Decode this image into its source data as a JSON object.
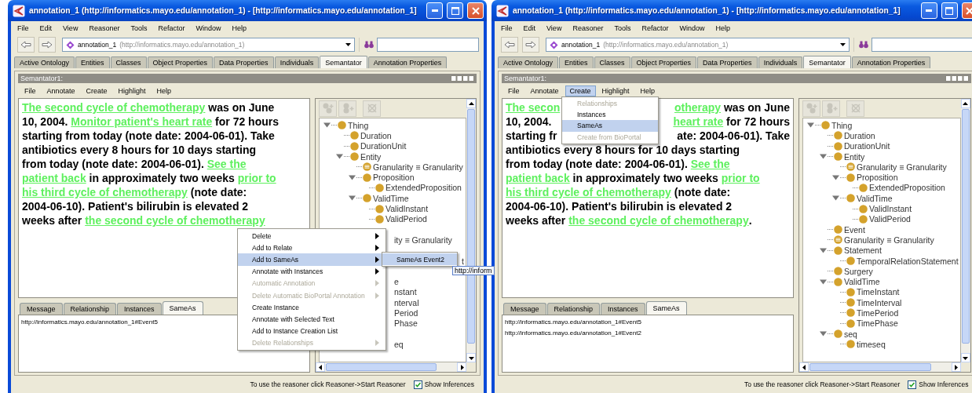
{
  "windows": [
    {
      "title": "annotation_1 (http://informatics.mayo.edu/annotation_1) - [http://informatics.mayo.edu/annotation_1]",
      "menu": [
        "File",
        "Edit",
        "View",
        "Reasoner",
        "Tools",
        "Refactor",
        "Window",
        "Help"
      ],
      "ontology": {
        "name": "annotation_1",
        "iri": "(http://informatics.mayo.edu/annotation_1)"
      },
      "tabs": [
        {
          "label": "Active Ontology",
          "selected": false
        },
        {
          "label": "Entities",
          "selected": false
        },
        {
          "label": "Classes",
          "selected": false
        },
        {
          "label": "Object Properties",
          "selected": false
        },
        {
          "label": "Data Properties",
          "selected": false
        },
        {
          "label": "Individuals",
          "selected": false
        },
        {
          "label": "Semantator",
          "selected": true
        },
        {
          "label": "Annotation Properties",
          "selected": false
        }
      ],
      "view": {
        "title": "Semantator1:",
        "menu": [
          {
            "label": "File",
            "selected": false
          },
          {
            "label": "Annotate",
            "selected": false
          },
          {
            "label": "Create",
            "selected": false
          },
          {
            "label": "Highlight",
            "selected": false
          },
          {
            "label": "Help",
            "selected": false
          }
        ],
        "lines": [
          {
            "kind": "full",
            "segments": [
              {
                "text": "The second cycle of chemotherapy",
                "link": true
              },
              {
                "text": " was on June",
                "link": false
              }
            ]
          },
          {
            "kind": "full",
            "segments": [
              {
                "text": "10, 2004. ",
                "link": false
              },
              {
                "text": "Monitor patient's heart rate",
                "link": true
              },
              {
                "text": " for 72 hours",
                "link": false
              }
            ]
          },
          {
            "kind": "full",
            "segments": [
              {
                "text": "starting from today (note date: 2004-06-01). Take",
                "link": false
              }
            ]
          },
          {
            "kind": "full",
            "segments": [
              {
                "text": "antibiotics every 8 hours for 10 days starting",
                "link": false
              }
            ]
          },
          {
            "kind": "full",
            "segments": [
              {
                "text": "from today (note date: 2004-06-01). ",
                "link": false
              },
              {
                "text": "See the",
                "link": true
              }
            ]
          },
          {
            "kind": "full",
            "segments": [
              {
                "text": "patient back",
                "link": true
              },
              {
                "text": " in approximately two weeks ",
                "link": false
              },
              {
                "text": "prior to",
                "link": true
              }
            ]
          },
          {
            "kind": "full",
            "segments": [
              {
                "text": "his third cycle of chemotherapy",
                "link": true
              },
              {
                "text": " (note date:",
                "link": false
              }
            ]
          },
          {
            "kind": "full",
            "segments": [
              {
                "text": "2004-06-10). Patient's bilirubin is elevated 2",
                "link": false
              }
            ]
          },
          {
            "kind": "full",
            "segments": [
              {
                "text": "weeks after ",
                "link": false
              },
              {
                "text": "the second cycle of chemotherapy",
                "link": true
              }
            ]
          }
        ],
        "tree": [
          {
            "label": "Thing",
            "kind": "class",
            "expanded": true,
            "children": [
              {
                "label": "Duration",
                "kind": "class"
              },
              {
                "label": "DurationUnit",
                "kind": "class"
              },
              {
                "label": "Entity",
                "kind": "class",
                "expanded": true,
                "children": [
                  {
                    "label": "Granularity ≡ Granularity",
                    "kind": "equivalent"
                  },
                  {
                    "label": "Proposition",
                    "kind": "class",
                    "expanded": true,
                    "children": [
                      {
                        "label": "ExtendedProposition",
                        "kind": "class"
                      }
                    ]
                  },
                  {
                    "label": "ValidTime",
                    "kind": "class",
                    "expanded": true,
                    "children": [
                      {
                        "label": "ValidInstant",
                        "kind": "class"
                      },
                      {
                        "label": "ValidPeriod",
                        "kind": "class"
                      }
                    ]
                  }
                ]
              },
              {
                "kind": "hidden"
              },
              {
                "label": "ity ≡ Granularity",
                "kind": "partial"
              },
              {
                "kind": "hidden",
                "children": [
                  {
                    "label": "t",
                    "kind": "tail"
                  }
                ]
              },
              {
                "kind": "hidden"
              },
              {
                "label": "e",
                "kind": "partial",
                "children": [
                  {
                    "label": "nstant",
                    "kind": "partial"
                  },
                  {
                    "label": "nterval",
                    "kind": "partial"
                  },
                  {
                    "label": "Period",
                    "kind": "partial"
                  },
                  {
                    "label": "Phase",
                    "kind": "partial"
                  }
                ]
              },
              {
                "kind": "hidden",
                "children": [
                  {
                    "label": "eq",
                    "kind": "partial"
                  }
                ]
              }
            ]
          }
        ],
        "bottom_tabs": [
          {
            "label": "Message",
            "selected": false
          },
          {
            "label": "Relationship",
            "selected": false
          },
          {
            "label": "Instances",
            "selected": false
          },
          {
            "label": "SameAs",
            "selected": true
          }
        ],
        "sameas": [
          "http://informatics.mayo.edu/annotation_1#Event5"
        ]
      },
      "overlay": {
        "kind": "context_menu",
        "items": [
          {
            "label": "Delete",
            "submenu": true,
            "disabled": false,
            "selected": false
          },
          {
            "label": "Add to Relate",
            "submenu": true,
            "disabled": false,
            "selected": false
          },
          {
            "label": "Add to SameAs",
            "submenu": true,
            "disabled": false,
            "selected": true
          },
          {
            "label": "Annotate with Instances",
            "submenu": true,
            "disabled": false,
            "selected": false
          },
          {
            "label": "Automatic Annotation",
            "submenu": true,
            "disabled": true,
            "selected": false
          },
          {
            "label": "Delete Automatic BioPortal Annotation",
            "submenu": true,
            "disabled": true,
            "selected": false
          },
          {
            "label": "Create Instance",
            "submenu": false,
            "disabled": false,
            "selected": false
          },
          {
            "label": "Annotate with Selected Text",
            "submenu": false,
            "disabled": false,
            "selected": false
          },
          {
            "label": "Add to Instance Creation List",
            "submenu": false,
            "disabled": false,
            "selected": false
          },
          {
            "label": "Delete Relationships",
            "submenu": true,
            "disabled": true,
            "selected": false
          }
        ],
        "submenu": [
          {
            "label": "SameAs Event2",
            "selected": true
          }
        ],
        "tooltip": "http://inform"
      },
      "status": {
        "text": "To use the reasoner click Reasoner->Start Reasoner",
        "checkbox": {
          "label": "Show Inferences",
          "checked": true
        }
      }
    },
    {
      "title": "annotation_1 (http://informatics.mayo.edu/annotation_1) - [http://informatics.mayo.edu/annotation_1]",
      "menu": [
        "File",
        "Edit",
        "View",
        "Reasoner",
        "Tools",
        "Refactor",
        "Window",
        "Help"
      ],
      "ontology": {
        "name": "annotation_1",
        "iri": "(http://informatics.mayo.edu/annotation_1)"
      },
      "tabs": [
        {
          "label": "Active Ontology",
          "selected": false
        },
        {
          "label": "Entities",
          "selected": false
        },
        {
          "label": "Classes",
          "selected": false
        },
        {
          "label": "Object Properties",
          "selected": false
        },
        {
          "label": "Data Properties",
          "selected": false
        },
        {
          "label": "Individuals",
          "selected": false
        },
        {
          "label": "Semantator",
          "selected": true
        },
        {
          "label": "Annotation Properties",
          "selected": false
        }
      ],
      "view": {
        "title": "Semantator1:",
        "menu": [
          {
            "label": "File",
            "selected": false
          },
          {
            "label": "Annotate",
            "selected": false
          },
          {
            "label": "Create",
            "selected": true
          },
          {
            "label": "Highlight",
            "selected": false
          },
          {
            "label": "Help",
            "selected": false
          }
        ],
        "lines": [
          {
            "kind": "split",
            "left": [
              {
                "text": "The secon",
                "link": true
              }
            ],
            "right": [
              {
                "text": "otherapy",
                "link": true
              },
              {
                "text": " was on June",
                "link": false
              }
            ]
          },
          {
            "kind": "split",
            "left": [
              {
                "text": "10, 2004.",
                "link": false
              }
            ],
            "right": [
              {
                "text": "heart rate",
                "link": true
              },
              {
                "text": " for 72 hours",
                "link": false
              }
            ]
          },
          {
            "kind": "split",
            "left": [
              {
                "text": "starting fr",
                "link": false
              }
            ],
            "right": [
              {
                "text": "ate: 2004-06-01). Take",
                "link": false
              }
            ]
          },
          {
            "kind": "full",
            "segments": [
              {
                "text": "antibiotics every 8 hours for 10 days starting",
                "link": false
              }
            ]
          },
          {
            "kind": "full",
            "segments": [
              {
                "text": "from today (note date: 2004-06-01). ",
                "link": false
              },
              {
                "text": "See the",
                "link": true
              }
            ]
          },
          {
            "kind": "full",
            "segments": [
              {
                "text": "patient back",
                "link": true
              },
              {
                "text": " in approximately two weeks ",
                "link": false
              },
              {
                "text": "prior to",
                "link": true
              }
            ]
          },
          {
            "kind": "full",
            "segments": [
              {
                "text": "his third cycle of chemotherapy",
                "link": true
              },
              {
                "text": " (note date:",
                "link": false
              }
            ]
          },
          {
            "kind": "full",
            "segments": [
              {
                "text": "2004-06-10). Patient's bilirubin is elevated 2",
                "link": false
              }
            ]
          },
          {
            "kind": "full",
            "segments": [
              {
                "text": "weeks after ",
                "link": false
              },
              {
                "text": "the second cycle of chemotherapy",
                "link": true
              },
              {
                "text": ".",
                "link": false
              }
            ]
          }
        ],
        "tree": [
          {
            "label": "Thing",
            "kind": "class",
            "expanded": true,
            "children": [
              {
                "label": "Duration",
                "kind": "class"
              },
              {
                "label": "DurationUnit",
                "kind": "class"
              },
              {
                "label": "Entity",
                "kind": "class",
                "expanded": true,
                "children": [
                  {
                    "label": "Granularity ≡ Granularity",
                    "kind": "equivalent"
                  },
                  {
                    "label": "Proposition",
                    "kind": "class",
                    "expanded": true,
                    "children": [
                      {
                        "label": "ExtendedProposition",
                        "kind": "class"
                      }
                    ]
                  },
                  {
                    "label": "ValidTime",
                    "kind": "class",
                    "expanded": true,
                    "children": [
                      {
                        "label": "ValidInstant",
                        "kind": "class"
                      },
                      {
                        "label": "ValidPeriod",
                        "kind": "class"
                      }
                    ]
                  }
                ]
              },
              {
                "label": "Event",
                "kind": "class"
              },
              {
                "label": "Granularity ≡ Granularity",
                "kind": "equivalent"
              },
              {
                "label": "Statement",
                "kind": "class",
                "expanded": true,
                "children": [
                  {
                    "label": "TemporalRelationStatement",
                    "kind": "class"
                  }
                ]
              },
              {
                "label": "Surgery",
                "kind": "class"
              },
              {
                "label": "ValidTime",
                "kind": "class",
                "expanded": true,
                "children": [
                  {
                    "label": "TimeInstant",
                    "kind": "class"
                  },
                  {
                    "label": "TimeInterval",
                    "kind": "class"
                  },
                  {
                    "label": "TimePeriod",
                    "kind": "class"
                  },
                  {
                    "label": "TimePhase",
                    "kind": "class"
                  }
                ]
              },
              {
                "label": "seq",
                "kind": "class",
                "expanded": true,
                "children": [
                  {
                    "label": "timeseq",
                    "kind": "class"
                  }
                ]
              }
            ]
          }
        ],
        "bottom_tabs": [
          {
            "label": "Message",
            "selected": false
          },
          {
            "label": "Relationship",
            "selected": false
          },
          {
            "label": "Instances",
            "selected": false
          },
          {
            "label": "SameAs",
            "selected": true
          }
        ],
        "sameas": [
          "http://informatics.mayo.edu/annotation_1#Event5",
          "http://informatics.mayo.edu/annotation_1#Event2"
        ]
      },
      "overlay": {
        "kind": "dropdown",
        "items": [
          {
            "label": "Relationships",
            "disabled": true,
            "selected": false
          },
          {
            "label": "Instances",
            "disabled": false,
            "selected": false
          },
          {
            "label": "SameAs",
            "disabled": false,
            "selected": true
          },
          {
            "label": "Create from BioPortal",
            "disabled": true,
            "selected": false
          }
        ]
      },
      "status": {
        "text": "To use the reasoner click Reasoner->Start Reasoner",
        "checkbox": {
          "label": "Show Inferences",
          "checked": true
        }
      }
    }
  ]
}
